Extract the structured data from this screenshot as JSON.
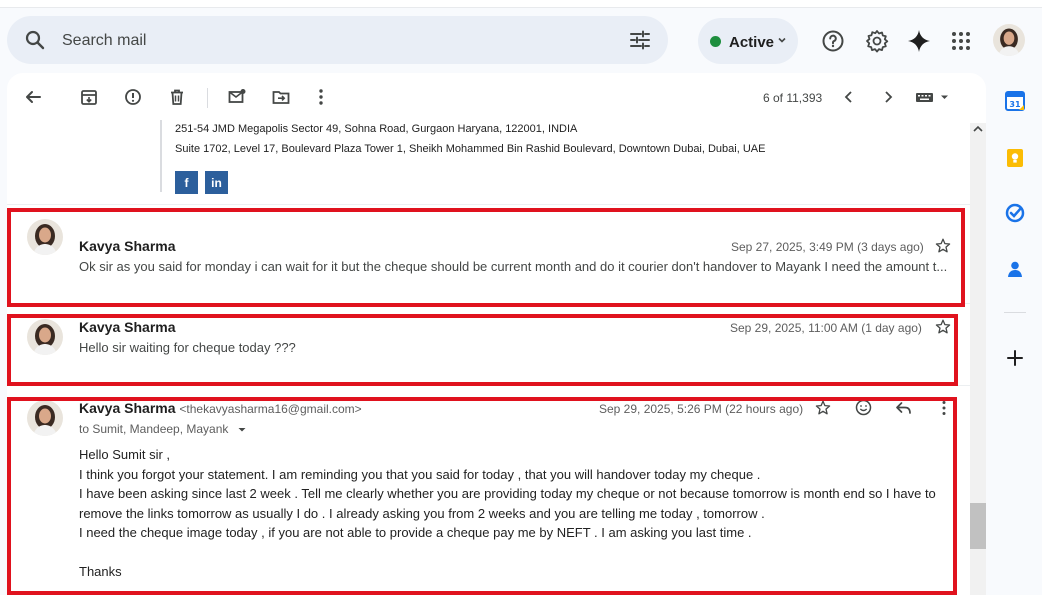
{
  "search": {
    "placeholder": "Search mail"
  },
  "status": {
    "label": "Active",
    "color": "#1e8e3e"
  },
  "toolbar": {
    "count": "6 of 11,393"
  },
  "signature": {
    "address1": "251-54 JMD Megapolis Sector 49, Sohna Road, Gurgaon Haryana, 122001, INDIA",
    "address2": "Suite 1702, Level 17, Boulevard Plaza Tower 1, Sheikh Mohammed Bin Rashid Boulevard, Downtown Dubai, Dubai, UAE",
    "facebook": "f",
    "linkedin": "in"
  },
  "messages": [
    {
      "sender": "Kavya Sharma",
      "date": "Sep 27, 2025, 3:49 PM (3 days ago)",
      "snippet": "Ok sir as you said for monday i can wait for it but the cheque should be current month and do it courier don't handover to Mayank I need the amount t..."
    },
    {
      "sender": "Kavya Sharma",
      "date": "Sep 29, 2025, 11:00 AM (1 day ago)",
      "snippet": "Hello sir waiting for cheque today ???"
    },
    {
      "sender": "Kavya Sharma",
      "email": "<thekavyasharma16@gmail.com>",
      "date": "Sep 29, 2025, 5:26 PM (22 hours ago)",
      "to": "to Sumit, Mandeep, Mayank",
      "body": [
        "Hello Sumit sir ,",
        "I think you forgot your statement. I am reminding you that you said for today , that you will handover today my cheque .",
        "I have been asking since last 2 week . Tell me clearly whether you are providing today my cheque or not because tomorrow is month end so I have to",
        "remove the links tomorrow as usually I do . I already asking you from 2 weeks and you are telling me today , tomorrow .",
        "I need the cheque image today , if you are not able to provide a cheque pay me by NEFT . I am asking you last time .",
        "",
        "Thanks"
      ]
    }
  ],
  "colors": {
    "highlight": "#e0121e",
    "calendar": "#1a73e8",
    "keep": "#fbbc04",
    "tasks": "#1a73e8",
    "contacts": "#1a73e8"
  },
  "rail": {
    "calendar_day": "31"
  }
}
